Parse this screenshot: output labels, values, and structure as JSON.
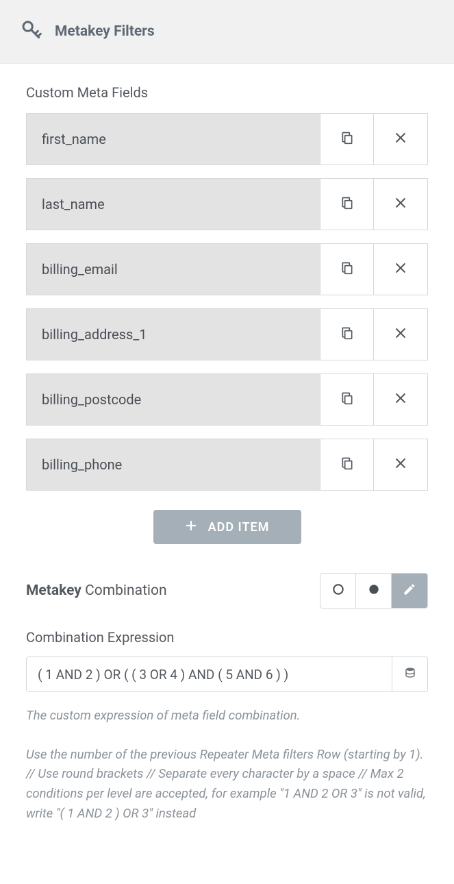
{
  "header": {
    "title": "Metakey Filters"
  },
  "custom_meta_fields": {
    "label": "Custom Meta Fields",
    "items": [
      {
        "name": "first_name"
      },
      {
        "name": "last_name"
      },
      {
        "name": "billing_email"
      },
      {
        "name": "billing_address_1"
      },
      {
        "name": "billing_postcode"
      },
      {
        "name": "billing_phone"
      }
    ],
    "add_item_label": "ADD ITEM"
  },
  "metakey_combination": {
    "label_strong": "Metakey",
    "label_rest": " Combination",
    "active_mode": "custom"
  },
  "combination_expression": {
    "label": "Combination Expression",
    "value": "( 1 AND 2 ) OR ( ( 3 OR 4 ) AND ( 5 AND 6 ) )",
    "help1": "The custom expression of meta field combination.",
    "help2": "Use the number of the previous Repeater Meta filters Row (starting by 1). // Use round brackets // Separate every character by a space // Max 2 conditions per level are accepted, for example \"1 AND 2 OR 3\" is not valid, write \"( 1 AND 2 ) OR 3\" instead"
  }
}
